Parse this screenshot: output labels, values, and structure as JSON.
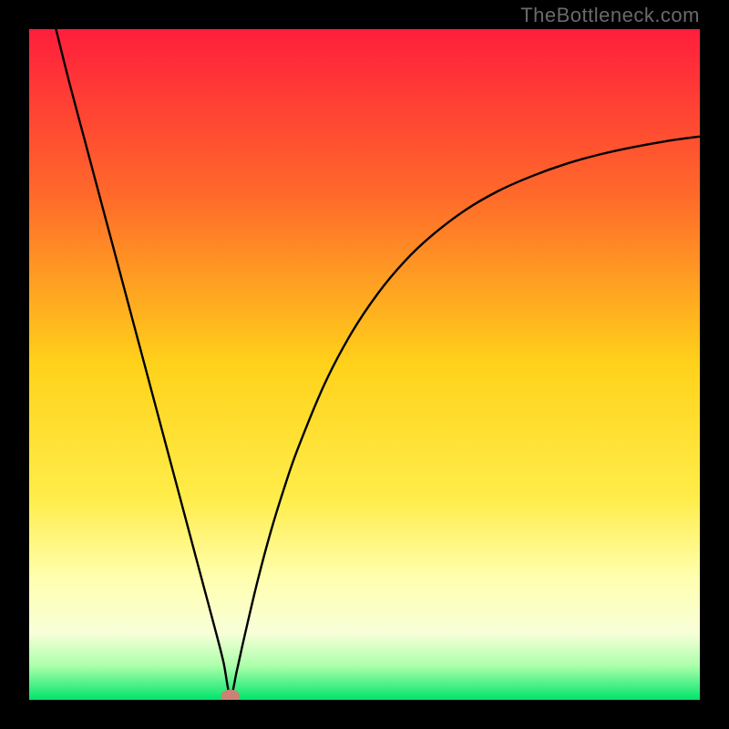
{
  "attribution": "TheBottleneck.com",
  "chart_data": {
    "type": "line",
    "title": "",
    "xlabel": "",
    "ylabel": "",
    "xlim": [
      0,
      100
    ],
    "ylim": [
      0,
      100
    ],
    "grid": false,
    "legend": false,
    "gradient_stops": [
      {
        "pct": 0,
        "color": "#ff1e3c"
      },
      {
        "pct": 25,
        "color": "#ff6a2a"
      },
      {
        "pct": 50,
        "color": "#ffd21a"
      },
      {
        "pct": 70,
        "color": "#ffed4a"
      },
      {
        "pct": 82,
        "color": "#ffffb0"
      },
      {
        "pct": 90,
        "color": "#f8ffd8"
      },
      {
        "pct": 95,
        "color": "#aaffaa"
      },
      {
        "pct": 100,
        "color": "#00e46b"
      }
    ],
    "marker": {
      "x": 30,
      "y": 0,
      "color": "#c98273",
      "rx": 1.4,
      "ry": 1.0
    },
    "series": [
      {
        "name": "bottleneck-curve",
        "x": [
          4,
          6,
          8,
          10,
          12,
          14,
          16,
          18,
          20,
          22,
          24,
          26,
          28,
          29,
          30,
          31,
          32,
          34,
          36,
          38,
          40,
          44,
          48,
          52,
          56,
          60,
          65,
          70,
          75,
          80,
          85,
          90,
          95,
          100
        ],
        "y": [
          100,
          92,
          84.5,
          77,
          69.5,
          62,
          54.5,
          47,
          39.5,
          32,
          24.5,
          17,
          9.5,
          5.5,
          0.6,
          4.5,
          9,
          17.5,
          25,
          31.5,
          37.3,
          47,
          54.6,
          60.6,
          65.4,
          69.2,
          73.0,
          75.9,
          78.1,
          79.9,
          81.3,
          82.4,
          83.3,
          84.0
        ]
      }
    ]
  }
}
